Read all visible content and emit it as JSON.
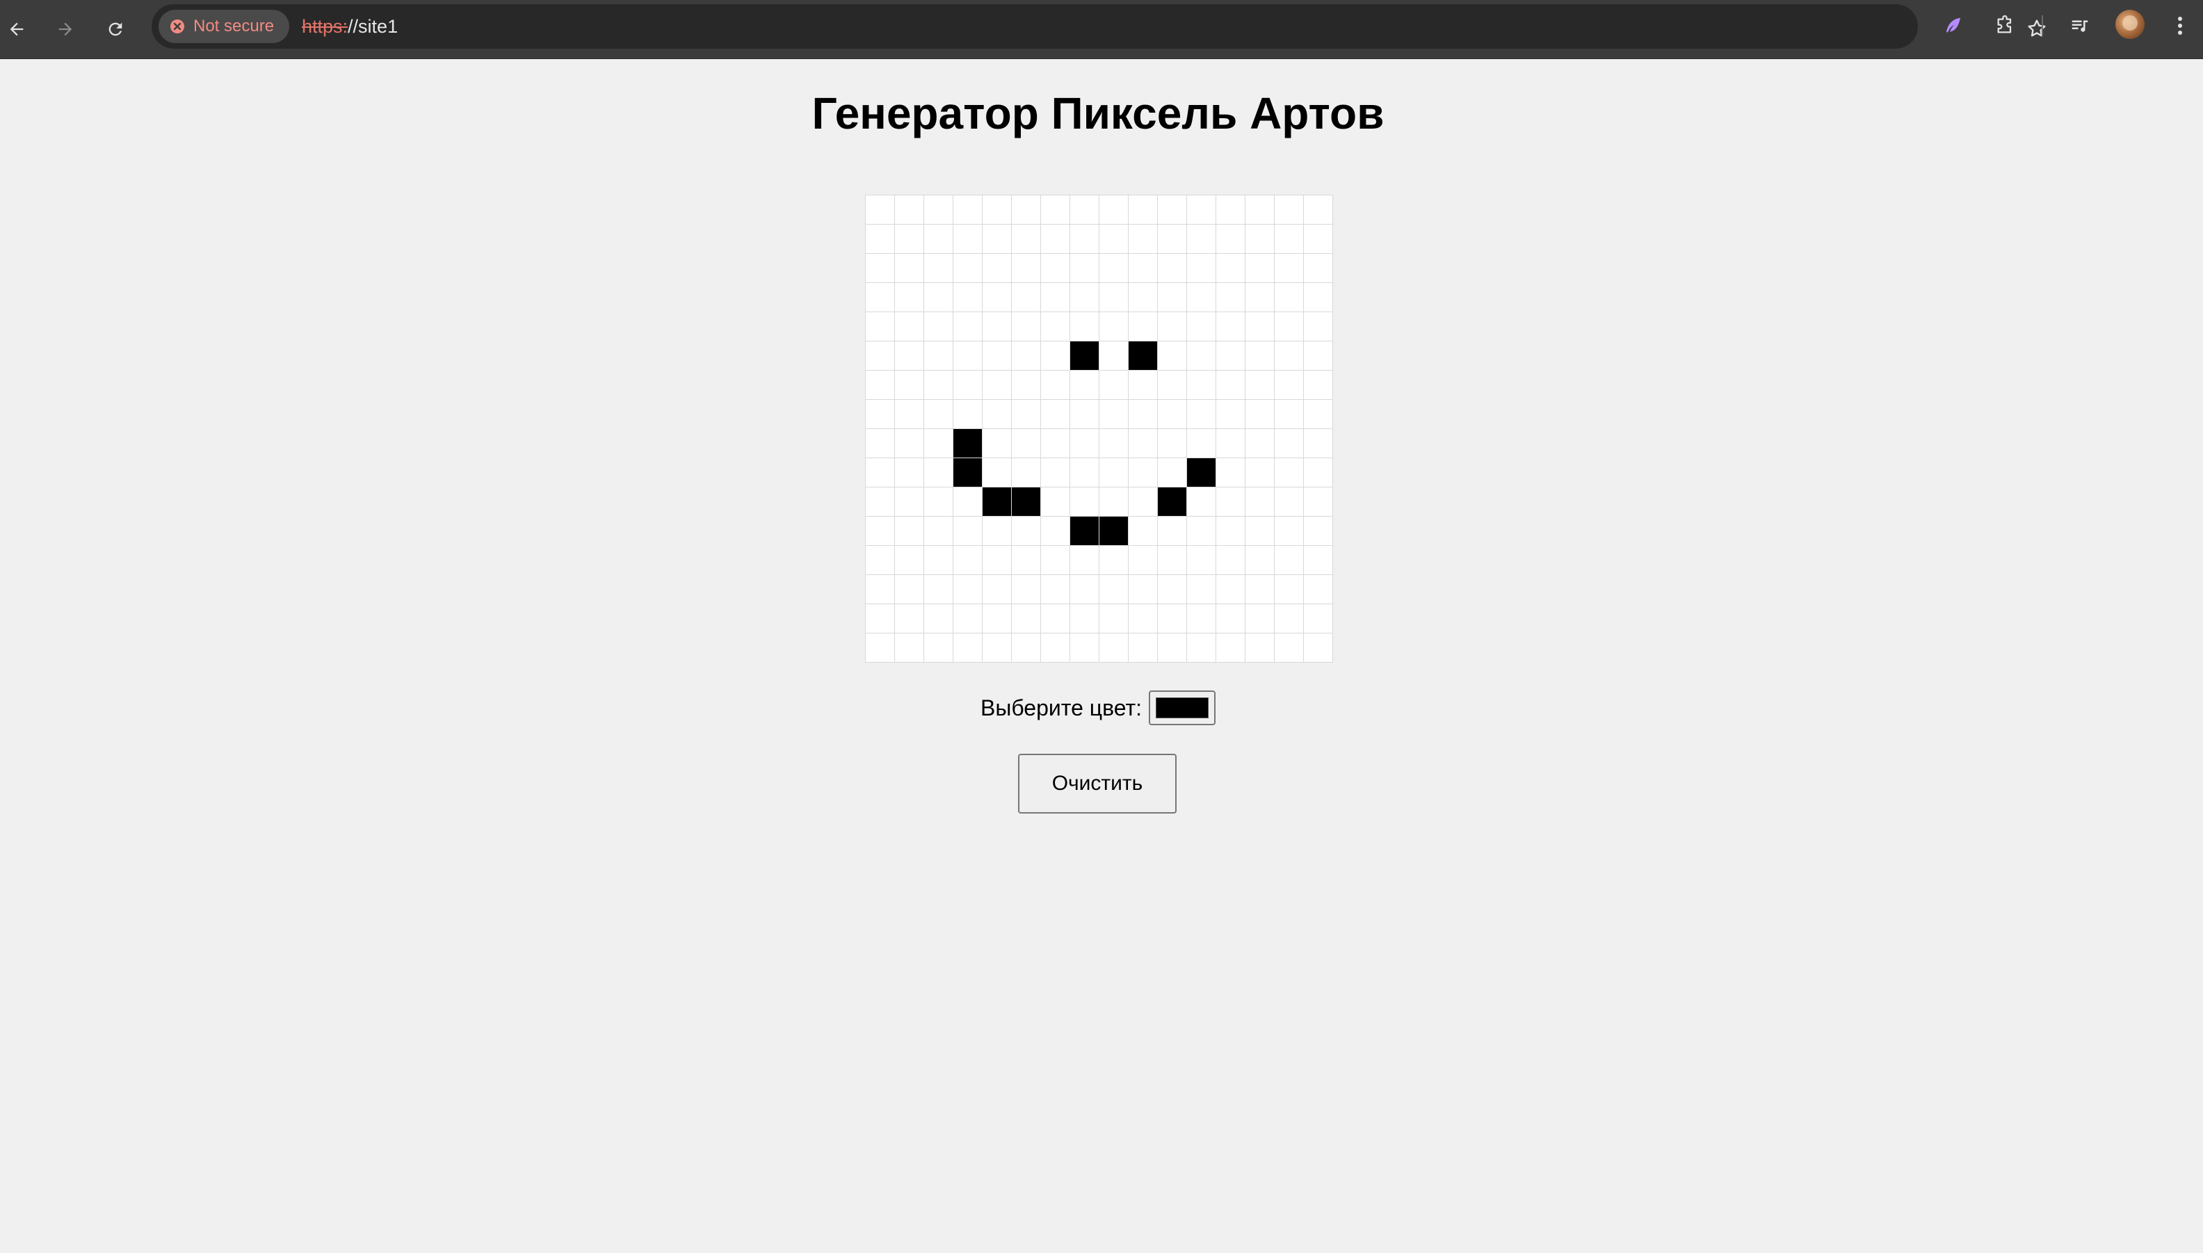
{
  "browser": {
    "security_label": "Not secure",
    "url_scheme": "https:",
    "url_rest": "//site1"
  },
  "page": {
    "title": "Генератор Пиксель Артов",
    "grid": {
      "rows": 16,
      "cols": 16,
      "empty_color": "#ffffff",
      "line_color": "#d8d8d8",
      "filled_color": "#000000",
      "filled_cells": [
        [
          5,
          7
        ],
        [
          5,
          9
        ],
        [
          8,
          3
        ],
        [
          9,
          3
        ],
        [
          9,
          11
        ],
        [
          10,
          4
        ],
        [
          10,
          5
        ],
        [
          10,
          10
        ],
        [
          11,
          7
        ],
        [
          11,
          8
        ]
      ]
    },
    "picker_label": "Выберите цвет:",
    "picker_value": "#000000",
    "clear_label": "Очистить"
  }
}
